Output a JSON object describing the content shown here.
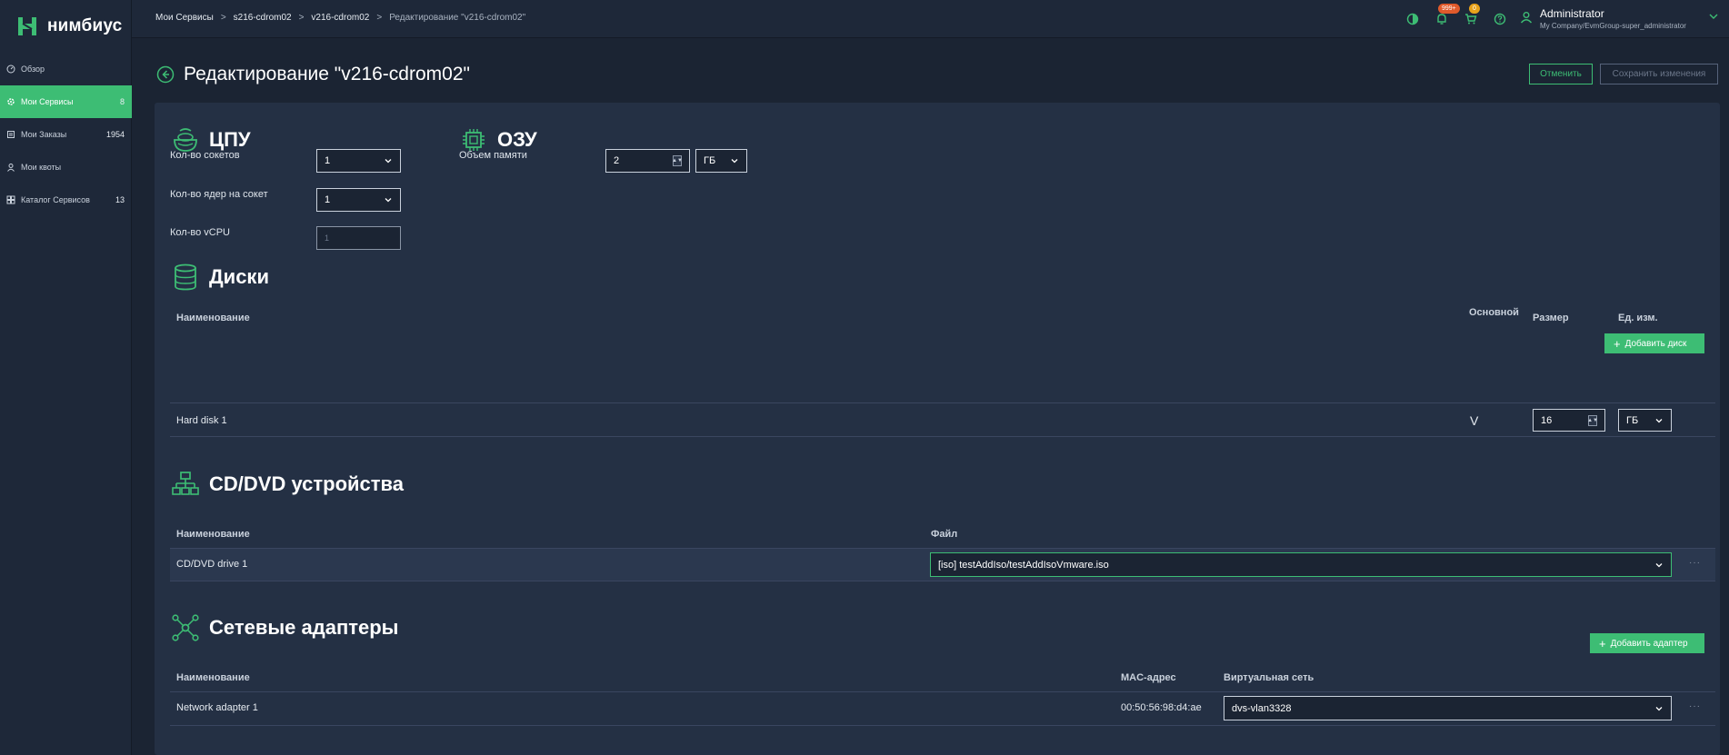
{
  "brand": {
    "name": "нимбиус"
  },
  "sidebar": {
    "items": [
      {
        "label": "Обзор",
        "count": "",
        "icon": "dashboard-icon",
        "active": false
      },
      {
        "label": "Мои Сервисы",
        "count": "8",
        "icon": "gear-icon",
        "active": true
      },
      {
        "label": "Мои Заказы",
        "count": "1954",
        "icon": "orders-icon",
        "active": false
      },
      {
        "label": "Мои квоты",
        "count": "",
        "icon": "user-icon",
        "active": false
      },
      {
        "label": "Каталог Сервисов",
        "count": "13",
        "icon": "catalog-icon",
        "active": false
      }
    ]
  },
  "topbar": {
    "breadcrumb": [
      "Мои Сервисы",
      "s216-cdrom02",
      "v216-cdrom02",
      "Редактирование \"v216-cdrom02\""
    ],
    "notifications_badge": "999+",
    "cart_badge": "0",
    "user_name": "Administrator",
    "user_group": "My Company/EvmGroup-super_administrator"
  },
  "page": {
    "title": "Редактирование \"v216-cdrom02\"",
    "cancel_label": "Отменить",
    "save_label": "Сохранить изменения"
  },
  "cpu": {
    "title": "ЦПУ",
    "sockets_label": "Кол-во сокетов",
    "sockets_value": "1",
    "cores_label": "Кол-во ядер на сокет",
    "cores_value": "1",
    "vcpu_label": "Кол-во vCPU",
    "vcpu_value": "1"
  },
  "ram": {
    "title": "ОЗУ",
    "memory_label": "Объем памяти",
    "memory_value": "2",
    "unit": "ГБ"
  },
  "disks": {
    "title": "Диски",
    "add_label": "Добавить диск",
    "columns": {
      "name": "Наименование",
      "primary": "Основной",
      "size": "Размер",
      "unit": "Ед. изм."
    },
    "rows": [
      {
        "name": "Hard disk 1",
        "primary": "V",
        "size": "16",
        "unit": "ГБ"
      }
    ]
  },
  "cdrom": {
    "title": "CD/DVD устройства",
    "columns": {
      "name": "Наименование",
      "file": "Файл"
    },
    "rows": [
      {
        "name": "CD/DVD drive 1",
        "file": "[iso] testAddIso/testAddIsoVmware.iso"
      }
    ]
  },
  "network": {
    "title": "Сетевые адаптеры",
    "add_label": "Добавить адаптер",
    "columns": {
      "name": "Наименование",
      "mac": "MAC-адрес",
      "vnet": "Виртуальная сеть"
    },
    "rows": [
      {
        "name": "Network adapter 1",
        "mac": "00:50:56:98:d4:ae",
        "vnet": "dvs-vlan3328"
      }
    ]
  },
  "colors": {
    "accent": "#3dbd74",
    "background": "#1b2433",
    "panel": "#243044"
  }
}
